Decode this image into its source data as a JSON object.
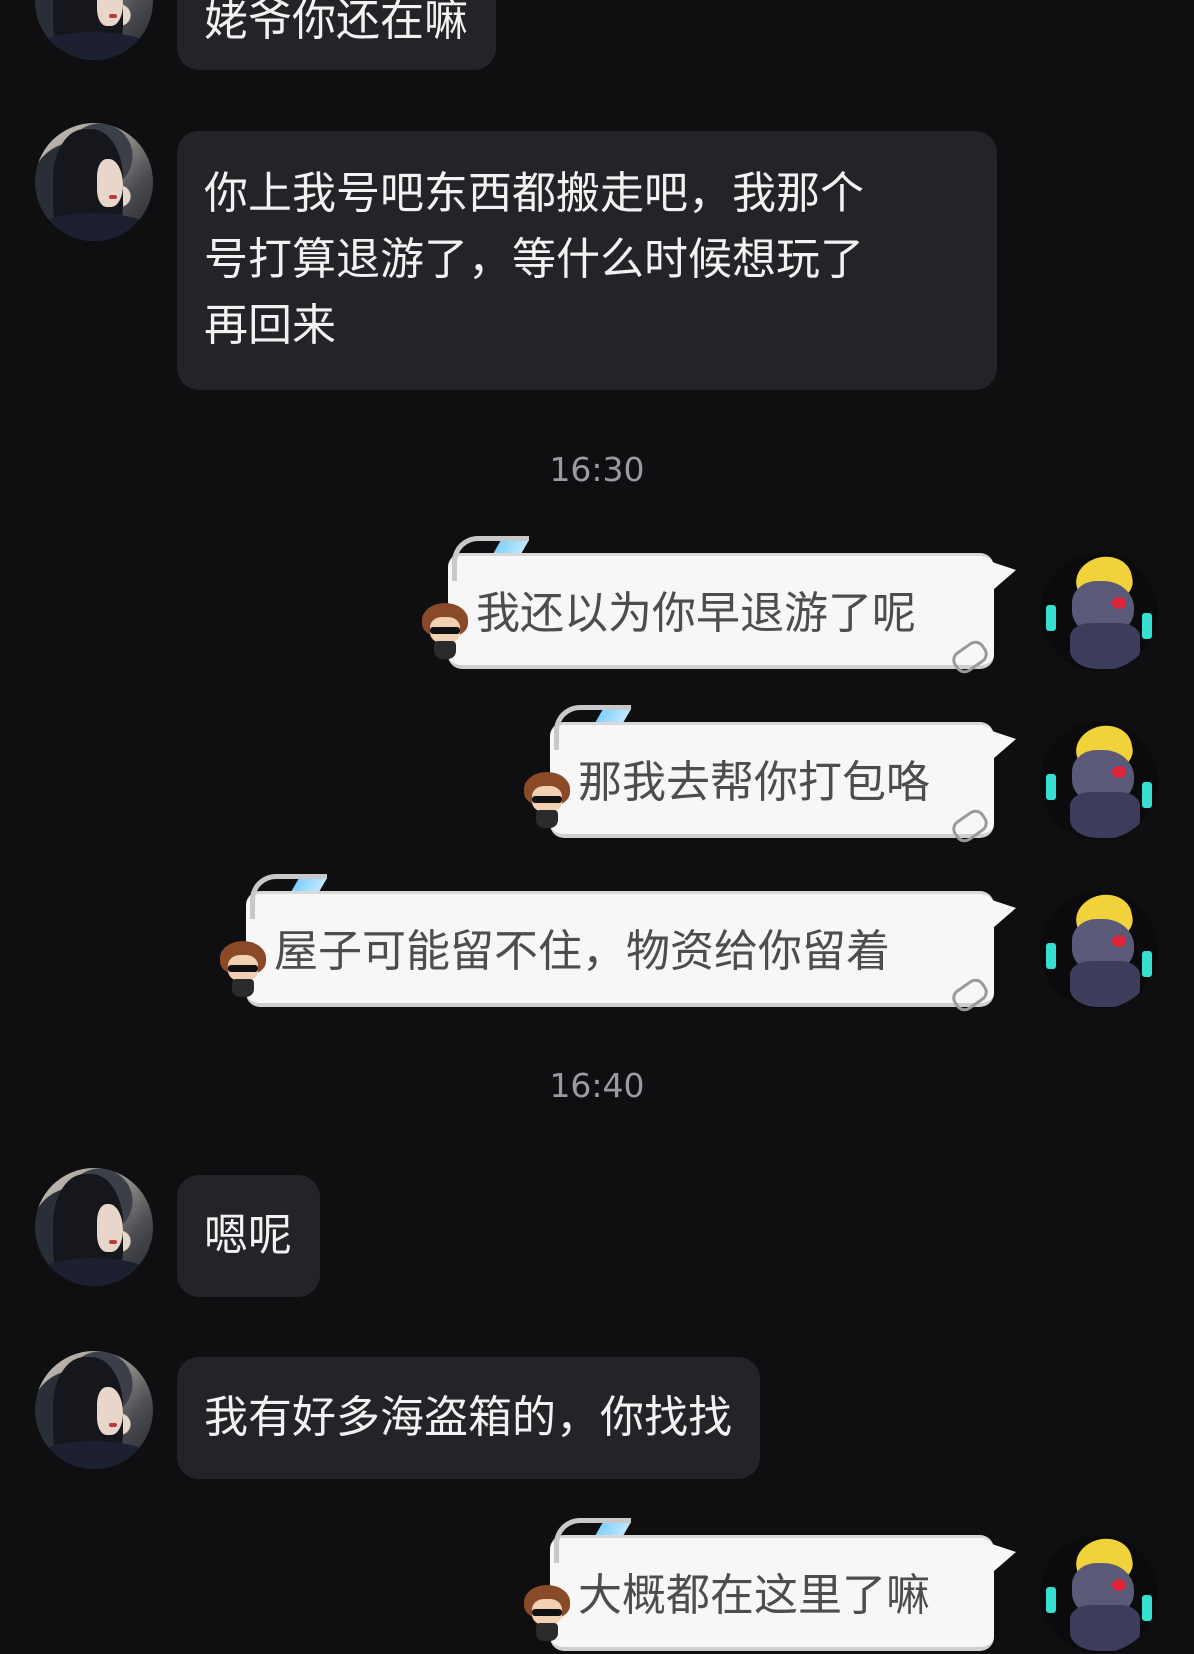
{
  "messages": [
    {
      "type": "in",
      "text": "姥爷你还在嘛"
    },
    {
      "type": "in",
      "lines": [
        "你上我号吧东西都搬走吧，我那个",
        "号打算退游了，等什么时候想玩了",
        "再回来"
      ]
    },
    {
      "type": "time",
      "text": "16:30"
    },
    {
      "type": "out",
      "text": "我还以为你早退游了呢"
    },
    {
      "type": "out",
      "text": "那我去帮你打包咯"
    },
    {
      "type": "out",
      "text": "屋子可能留不住，物资给你留着"
    },
    {
      "type": "time",
      "text": "16:40"
    },
    {
      "type": "in",
      "text": "嗯呢"
    },
    {
      "type": "in",
      "text": "我有好多海盗箱的，你找找"
    },
    {
      "type": "out",
      "text": "大概都在这里了嘛"
    }
  ],
  "icons": {
    "incoming_avatar": "avatar-girl-dark-hair",
    "outgoing_avatar": "avatar-pikachu-ninja",
    "bubble_decoration": "bubble-chibi-sunglasses"
  },
  "colors": {
    "background": "#0f0f11",
    "incoming_bubble": "#242428",
    "outgoing_bubble": "#f7f7f7",
    "timestamp": "#9a9aa0"
  }
}
